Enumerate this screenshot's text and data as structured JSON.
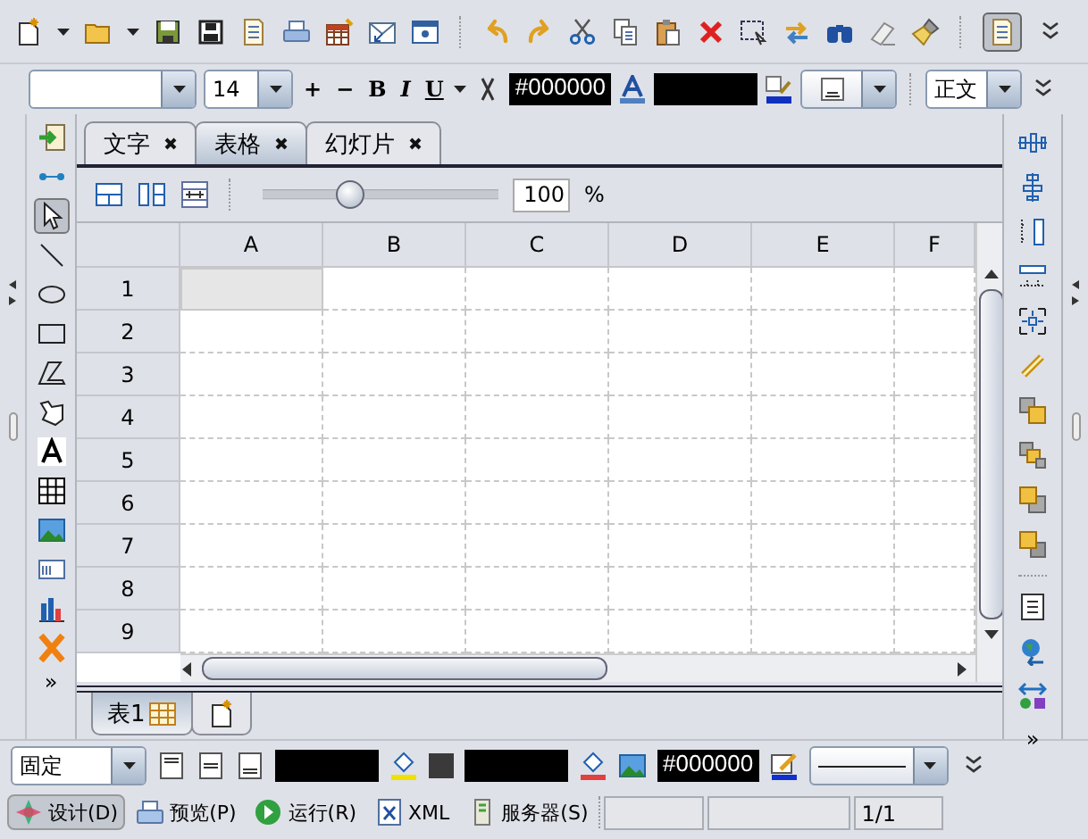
{
  "main_toolbar": {
    "layout_toggle_on": true
  },
  "format_bar": {
    "font_size": "14",
    "grow": "+",
    "shrink": "−",
    "bold": "B",
    "italic": "I",
    "underline": "U",
    "text_color": "#000000",
    "paragraph_style": "正文"
  },
  "left_toolbar": {
    "tools": [
      {
        "selected": false
      },
      {
        "selected": false
      },
      {
        "selected": true
      },
      {
        "selected": false
      },
      {
        "selected": false
      },
      {
        "selected": false
      },
      {
        "selected": false
      },
      {
        "selected": false
      },
      {
        "selected": false
      },
      {
        "selected": false
      },
      {
        "selected": false
      },
      {
        "selected": false
      },
      {
        "selected": false
      },
      {
        "selected": false
      }
    ],
    "more": "»"
  },
  "doc_tabs": [
    {
      "label": "文字",
      "selected": false
    },
    {
      "label": "表格",
      "selected": true
    },
    {
      "label": "幻灯片",
      "selected": false
    }
  ],
  "zoom": {
    "level": 0.36,
    "value": "100",
    "unit": "%"
  },
  "sheet": {
    "columns": [
      "A",
      "B",
      "C",
      "D",
      "E",
      "F"
    ],
    "rows": [
      {
        "label": "1",
        "cells_selected": [
          true,
          false,
          false,
          false,
          false,
          false
        ]
      },
      {
        "label": "2",
        "cells_selected": [
          false,
          false,
          false,
          false,
          false,
          false
        ]
      },
      {
        "label": "3",
        "cells_selected": [
          false,
          false,
          false,
          false,
          false,
          false
        ]
      },
      {
        "label": "4",
        "cells_selected": [
          false,
          false,
          false,
          false,
          false,
          false
        ]
      },
      {
        "label": "5",
        "cells_selected": [
          false,
          false,
          false,
          false,
          false,
          false
        ]
      },
      {
        "label": "6",
        "cells_selected": [
          false,
          false,
          false,
          false,
          false,
          false
        ]
      },
      {
        "label": "7",
        "cells_selected": [
          false,
          false,
          false,
          false,
          false,
          false
        ]
      },
      {
        "label": "8",
        "cells_selected": [
          false,
          false,
          false,
          false,
          false,
          false
        ]
      },
      {
        "label": "9",
        "cells_selected": [
          false,
          false,
          false,
          false,
          false,
          false
        ]
      }
    ]
  },
  "sheet_tabs": [
    {
      "label": "表1",
      "selected": true
    }
  ],
  "right_toolbar": {
    "more": "»"
  },
  "bottom_bar": {
    "row_height_mode": "固定",
    "line_color": "#000000"
  },
  "status_bar": {
    "modes": [
      {
        "label": "设计(D)",
        "selected": true
      },
      {
        "label": "预览(P)",
        "selected": false
      },
      {
        "label": "运行(R)",
        "selected": false
      },
      {
        "label": "XML",
        "selected": false
      },
      {
        "label": "服务器(S)",
        "selected": false
      }
    ],
    "page": "1/1"
  }
}
